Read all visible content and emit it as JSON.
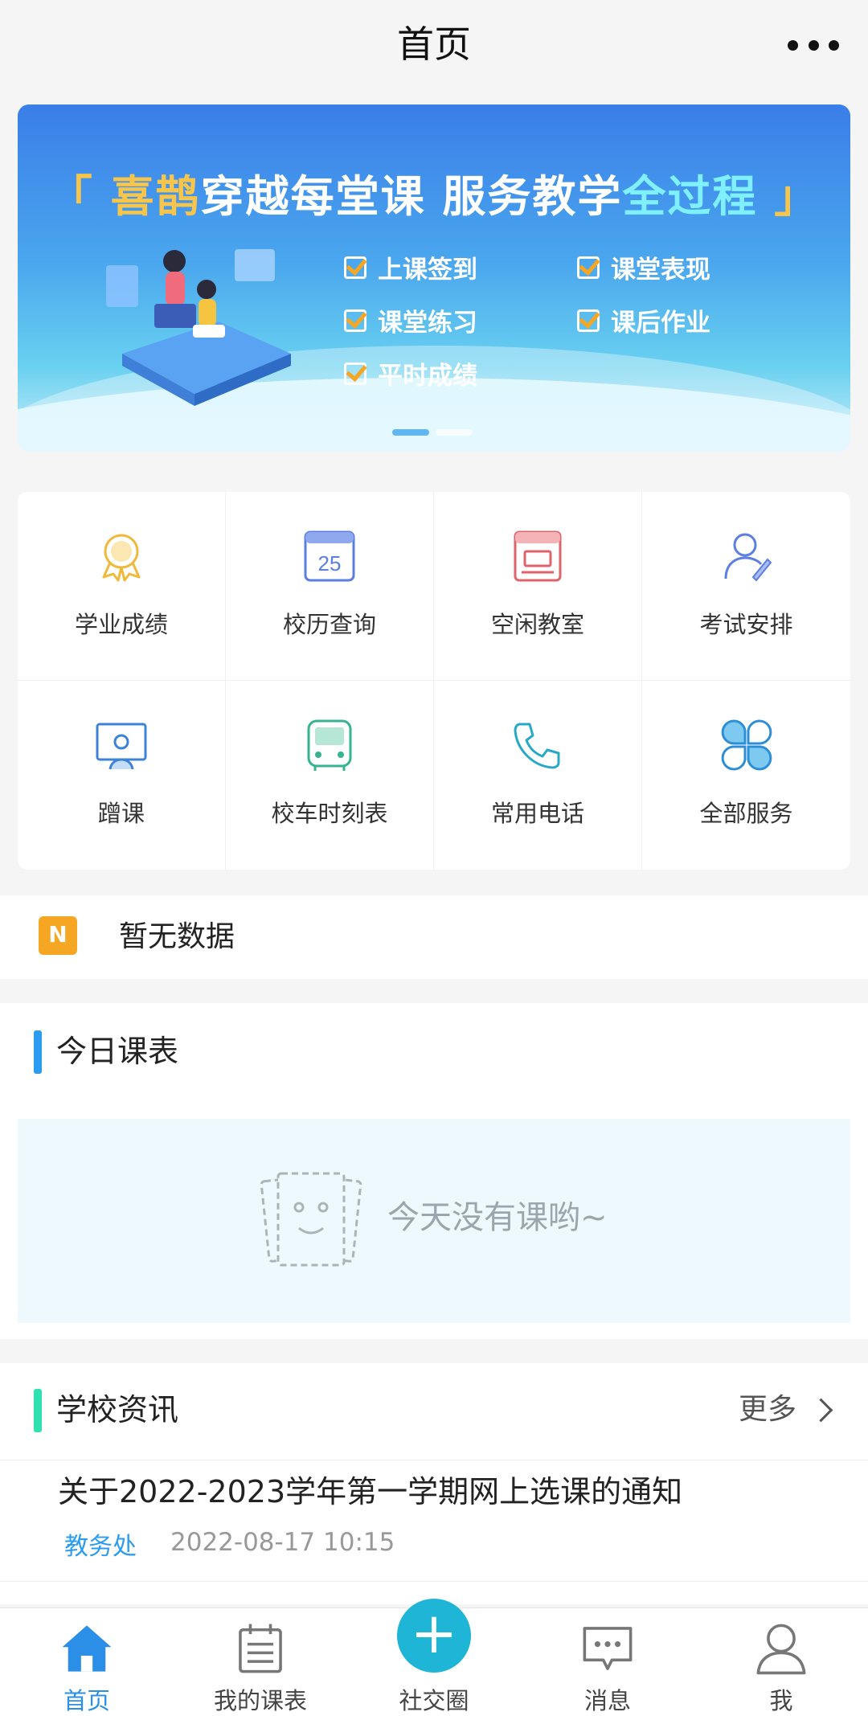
{
  "header": {
    "title": "首页",
    "more_label": "•••"
  },
  "banner": {
    "headline_open": "「 ",
    "headline_brand": "喜鹊",
    "headline_mid": "穿越每堂课 服务教学",
    "headline_hl": "全过程",
    "headline_close": " 」",
    "features": [
      "上课签到",
      "课堂表现",
      "课堂练习",
      "课后作业",
      "平时成绩"
    ]
  },
  "services": [
    {
      "label": "学业成绩",
      "icon": "award-icon"
    },
    {
      "label": "校历查询",
      "icon": "calendar-icon",
      "badge": "25"
    },
    {
      "label": "空闲教室",
      "icon": "classroom-icon"
    },
    {
      "label": "考试安排",
      "icon": "exam-icon"
    },
    {
      "label": "蹭课",
      "icon": "audit-class-icon"
    },
    {
      "label": "校车时刻表",
      "icon": "bus-icon"
    },
    {
      "label": "常用电话",
      "icon": "phone-icon"
    },
    {
      "label": "全部服务",
      "icon": "all-services-icon"
    }
  ],
  "notice": {
    "icon_text": "N",
    "text": "暂无数据"
  },
  "schedule": {
    "title": "今日课表",
    "empty_text": "今天没有课哟~"
  },
  "news": {
    "title": "学校资讯",
    "more_label": "更多",
    "items": [
      {
        "title": "关于2022-2023学年第一学期网上选课的通知",
        "dept": "教务处",
        "date": "2022-08-17 10:15"
      }
    ]
  },
  "tabbar": {
    "items": [
      {
        "label": "首页",
        "icon": "home-icon",
        "active": true
      },
      {
        "label": "我的课表",
        "icon": "schedule-icon"
      },
      {
        "label": "社交圈",
        "icon": "plus-icon"
      },
      {
        "label": "消息",
        "icon": "message-icon"
      },
      {
        "label": "我",
        "icon": "user-icon"
      }
    ]
  },
  "colors": {
    "accent": "#2b8fe8",
    "plus": "#1fb5d6",
    "notice_icon": "#f5a623"
  }
}
